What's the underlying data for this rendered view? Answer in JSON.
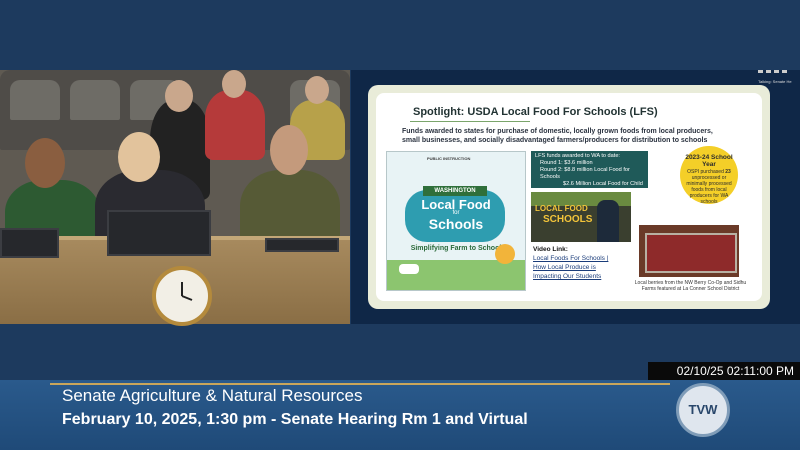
{
  "slide": {
    "title": "Spotlight: USDA Local Food For Schools (LFS)",
    "subtitle": "Funds awarded to states for purchase of domestic, locally grown foods from local producers, small businesses, and socially disadvantaged farmers/producers for distribution to schools",
    "poster": {
      "agency": "PUBLIC INSTRUCTION",
      "state": "WASHINGTON",
      "title_line1": "Local Food",
      "title_line2": "for",
      "title_line3": "Schools",
      "tagline": "Simplifying Farm to School"
    },
    "funds_box": {
      "heading": "LFS funds awarded to WA to date:",
      "round1": "Round 1:  $3.6 million",
      "round2": "Round 2: $8.8 million Local Food for Schools",
      "round2b": "$2.6 Million Local Food for Child"
    },
    "year_circle": {
      "year": "2023-24 School Year",
      "text_before": "OSPI purchased",
      "number": "23",
      "text_after": "unprocessed or minimally processed foods from local producers for WA schools"
    },
    "video": {
      "thumb_text_1": "LOCAL FOOD",
      "thumb_text_2": "SCHOOLS",
      "label": "Video Link:",
      "link1": "Local Foods For Schools |",
      "link2": "How Local Produce is",
      "link3": "Impacting Our Students"
    },
    "berries_caption": "Local berries from the NW Berry Co-Op and Sidhu Farms featured at La Conner School District"
  },
  "controls": {
    "talking_label": "Talking: Senate He"
  },
  "broadcast": {
    "timestamp": "02/10/25 02:11:00 PM",
    "committee": "Senate Agriculture & Natural Resources",
    "hearing": "February 10, 2025, 1:30 pm - Senate Hearing Rm 1 and Virtual",
    "logo": "TVW"
  },
  "colors": {
    "background": "#1d3a5e",
    "lower_third": "#2a5a8c",
    "accent_gold": "#c9a65b",
    "funds_box": "#1f5a59",
    "year_circle": "#f4cf28"
  }
}
